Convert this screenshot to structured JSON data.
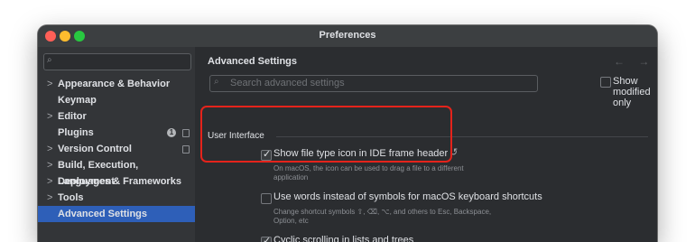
{
  "window": {
    "title": "Preferences"
  },
  "sidebar": {
    "search_icon": "search-icon",
    "items": [
      {
        "label": "Appearance & Behavior",
        "chevron": ">"
      },
      {
        "label": "Keymap",
        "chevron": ""
      },
      {
        "label": "Editor",
        "chevron": ">"
      },
      {
        "label": "Plugins",
        "chevron": "",
        "badge": "1"
      },
      {
        "label": "Version Control",
        "chevron": ">"
      },
      {
        "label": "Build, Execution, Deployment",
        "chevron": ">"
      },
      {
        "label": "Languages & Frameworks",
        "chevron": ">"
      },
      {
        "label": "Tools",
        "chevron": ">"
      },
      {
        "label": "Advanced Settings",
        "chevron": "",
        "selected": true
      }
    ]
  },
  "main": {
    "title": "Advanced Settings",
    "nav_arrows": "← →",
    "search_placeholder": "Search advanced settings",
    "show_modified_only": "Show modified only",
    "section_title": "User Interface",
    "options": [
      {
        "label": "Show file type icon in IDE frame header",
        "checked": true,
        "description_lines": [
          "On macOS, the icon can be used to drag a file to a different",
          "application"
        ]
      },
      {
        "label": "Use words instead of symbols for macOS keyboard shortcuts",
        "checked": false,
        "description_lines": [
          "Change shortcut symbols ⇧, ⌫, ⌥, and others to Esc, Backspace,",
          "Option, etc"
        ]
      },
      {
        "label": "Cyclic scrolling in lists and trees",
        "checked": true,
        "description_lines": []
      }
    ],
    "reset_icon": "reset-icon"
  },
  "colors": {
    "accent_selection": "#2e5fb8",
    "highlight_box": "#e5231b",
    "background": "#2b2d30"
  }
}
